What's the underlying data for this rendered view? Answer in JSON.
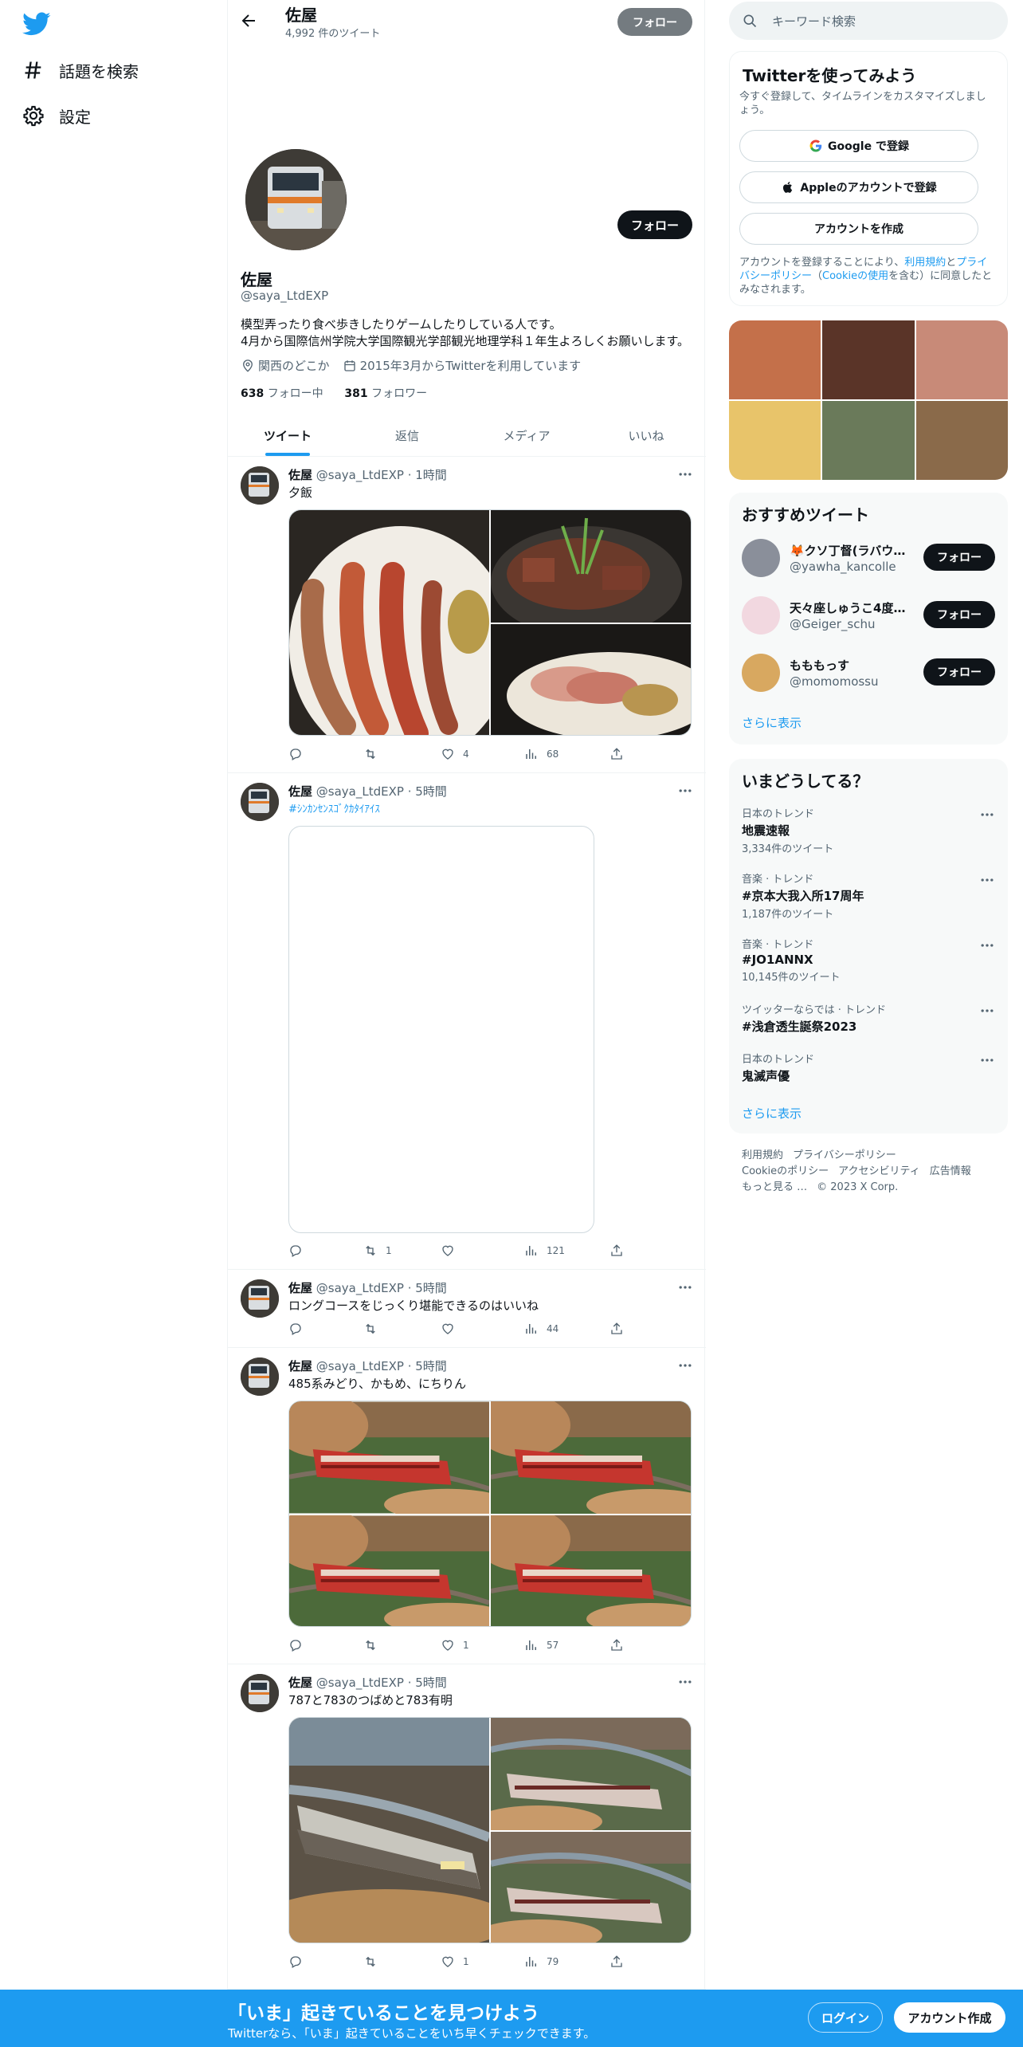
{
  "nav": {
    "explore_label": "話題を検索",
    "settings_label": "設定"
  },
  "profile": {
    "name": "佐屋",
    "tweet_count": "4,992 件のツイート",
    "follow_top": "フォロー",
    "follow_main": "フォロー",
    "handle": "@saya_LtdEXP",
    "bio_line1": "模型弄ったり食べ歩きしたりゲームしたりしている人です。",
    "bio_line2": "4月から国際信州学院大学国際観光学部観光地理学科１年生よろしくお願いします。",
    "location": "関西のどこか",
    "joined": "2015年3月からTwitterを利用しています",
    "following_count": "638",
    "following_label": "フォロー中",
    "followers_count": "381",
    "followers_label": "フォロワー"
  },
  "tabs": [
    "ツイート",
    "返信",
    "メディア",
    "いいね"
  ],
  "tweets": [
    {
      "name": "佐屋",
      "handle": "@saya_LtdEXP",
      "time": "· 1時間",
      "text": "夕飯",
      "reply": "",
      "retweet": "",
      "like": "4",
      "views": "68"
    },
    {
      "name": "佐屋",
      "handle": "@saya_LtdEXP",
      "time": "· 5時間",
      "text": "#ｼﾝｶﾝｾﾝｽｺﾞｸｶﾀｲｱｲｽ",
      "reply": "",
      "retweet": "1",
      "like": "",
      "views": "121"
    },
    {
      "name": "佐屋",
      "handle": "@saya_LtdEXP",
      "time": "· 5時間",
      "text": "ロングコースをじっくり堪能できるのはいいね",
      "reply": "",
      "retweet": "",
      "like": "",
      "views": "44"
    },
    {
      "name": "佐屋",
      "handle": "@saya_LtdEXP",
      "time": "· 5時間",
      "text": "485系みどり、かもめ、にちりん",
      "reply": "",
      "retweet": "",
      "like": "1",
      "views": "57"
    },
    {
      "name": "佐屋",
      "handle": "@saya_LtdEXP",
      "time": "· 5時間",
      "text": "787と783のつばめと783有明",
      "reply": "",
      "retweet": "",
      "like": "1",
      "views": "79"
    }
  ],
  "sidebar": {
    "search_placeholder": "キーワード検索",
    "signup": {
      "title": "Twitterを使ってみよう",
      "subtitle": "今すぐ登録して、タイムラインをカスタマイズしましょう。",
      "google": "Google で登録",
      "apple": "Appleのアカウントで登録",
      "create": "アカウントを作成",
      "legal_a": "アカウントを登録することにより、",
      "legal_terms": "利用規約",
      "legal_and": "と",
      "legal_privacy": "プライバシーポリシー",
      "legal_open": "（",
      "legal_cookie": "Cookieの使用",
      "legal_b": "を含む）に同意したとみなされます。"
    },
    "recommended": {
      "title": "おすすめツイート",
      "users": [
        {
          "name": "🦊クソ丁督(ラバウ…",
          "handle": "@yawha_kancolle",
          "btn": "フォロー"
        },
        {
          "name": "天々座しゅうこ4度目…",
          "handle": "@Geiger_schu",
          "btn": "フォロー"
        },
        {
          "name": "もももっす",
          "handle": "@momomossu",
          "btn": "フォロー"
        }
      ],
      "more": "さらに表示"
    },
    "trends": {
      "title": "いまどうしてる？",
      "items": [
        {
          "cat": "日本のトレンド",
          "title": "地震速報",
          "count": "3,334件のツイート"
        },
        {
          "cat": "音楽 · トレンド",
          "title": "#京本大我入所17周年",
          "count": "1,187件のツイート"
        },
        {
          "cat": "音楽 · トレンド",
          "title": "#JO1ANNX",
          "count": "10,145件のツイート"
        },
        {
          "cat": "ツイッターならでは · トレンド",
          "title": "#浅倉透生誕祭2023",
          "count": ""
        },
        {
          "cat": "日本のトレンド",
          "title": "鬼滅声優",
          "count": ""
        }
      ],
      "more": "さらに表示"
    },
    "footer": {
      "terms": "利用規約",
      "privacy": "プライバシーポリシー",
      "cookie": "Cookieのポリシー",
      "access": "アクセシビリティ",
      "ads": "広告情報",
      "more": "もっと見る …",
      "copy": "© 2023 X Corp."
    }
  },
  "bottom_bar": {
    "title": "「いま」起きていることを見つけよう",
    "subtitle": "Twitterなら、「いま」起きていることをいち早くチェックできます。",
    "login": "ログイン",
    "signup": "アカウント作成"
  },
  "colors": {
    "accent": "#1d9bf0",
    "text": "#0f1419",
    "muted": "#536471"
  }
}
